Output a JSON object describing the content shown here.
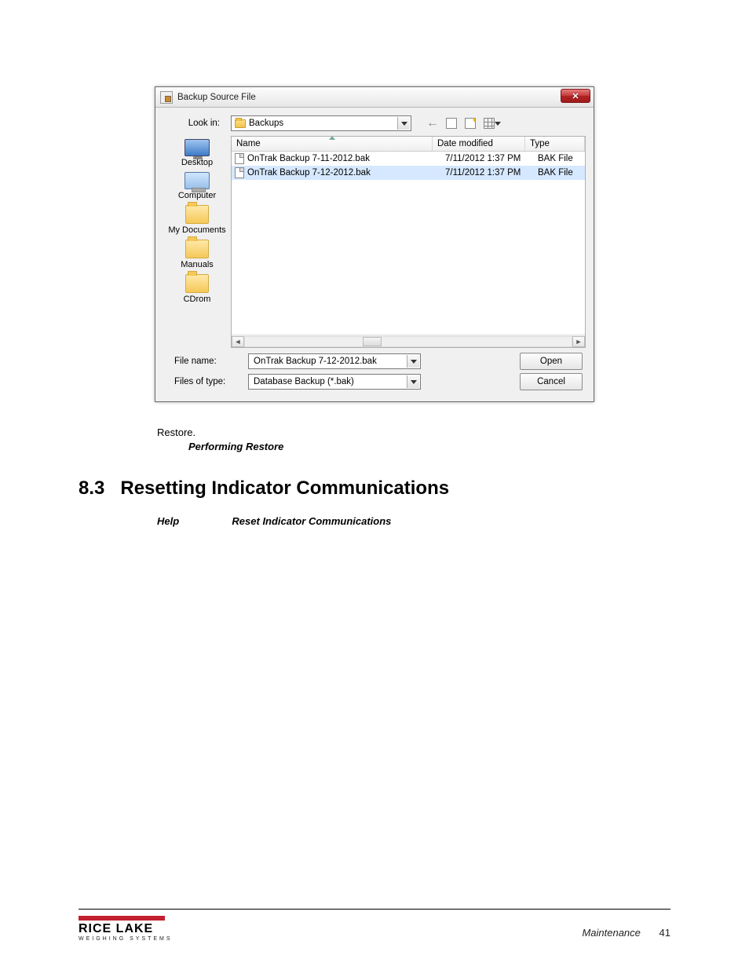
{
  "dialog": {
    "title": "Backup Source File",
    "lookin_label": "Look in:",
    "lookin_value": "Backups",
    "places": [
      {
        "label": "Desktop",
        "kind": "desktop"
      },
      {
        "label": "Computer",
        "kind": "computer"
      },
      {
        "label": "My Documents",
        "kind": "folder"
      },
      {
        "label": "Manuals",
        "kind": "folder"
      },
      {
        "label": "CDrom",
        "kind": "folder"
      }
    ],
    "columns": {
      "name": "Name",
      "date": "Date modified",
      "type": "Type"
    },
    "files": [
      {
        "name": "OnTrak Backup 7-11-2012.bak",
        "date": "7/11/2012 1:37 PM",
        "type": "BAK File",
        "selected": false
      },
      {
        "name": "OnTrak Backup 7-12-2012.bak",
        "date": "7/11/2012 1:37 PM",
        "type": "BAK File",
        "selected": true
      }
    ],
    "filename_label": "File name:",
    "filename_value": "OnTrak Backup 7-12-2012.bak",
    "filetype_label": "Files of type:",
    "filetype_value": "Database Backup (*.bak)",
    "open_btn": "Open",
    "cancel_btn": "Cancel"
  },
  "doc": {
    "restore": "Restore",
    "performing_restore": "Performing Restore",
    "section_num": "8.3",
    "section_title": "Resetting Indicator Communications",
    "help": "Help",
    "reset_item": "Reset Indicator Communications"
  },
  "footer": {
    "brand": "RICE LAKE",
    "brand_sub": "WEIGHING SYSTEMS",
    "section": "Maintenance",
    "page": "41"
  }
}
